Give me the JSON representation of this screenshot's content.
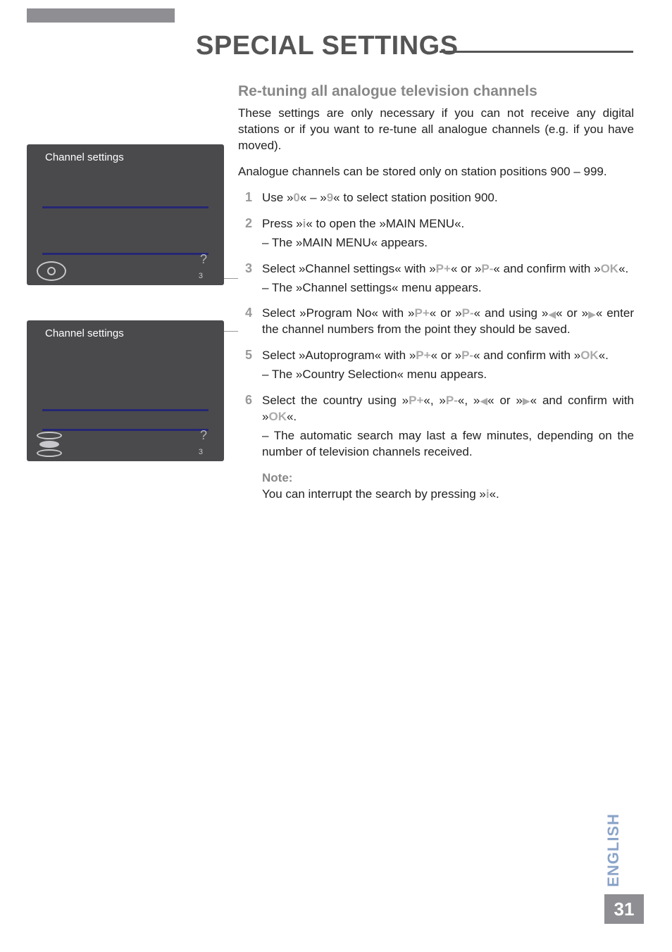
{
  "page": {
    "title": "SPECIAL SETTINGS",
    "language": "ENGLISH",
    "number": "31"
  },
  "sidebar": {
    "panel1": {
      "title": "Channel settings",
      "page": "3"
    },
    "panel2": {
      "title": "Channel settings",
      "page": "3"
    }
  },
  "content": {
    "heading": "Re-tuning all analogue television channels",
    "intro1": "These settings are only necessary if you can not receive any digital stations or if you want to re-tune all analogue channels (e.g. if you have moved).",
    "intro2_a": "Analogue channels can be stored only on station positions ",
    "intro2_b": "900 – 999.",
    "steps": {
      "s1": {
        "n": "1",
        "a": "Use »",
        "b0": "0",
        "b": "« – »",
        "b9": "9",
        "c": "« to select station position 900."
      },
      "s2": {
        "n": "2",
        "a": "Press »",
        "ik": "i",
        "b": "« to open the »MAIN MENU«.",
        "sub": "– The »MAIN MENU« appears."
      },
      "s3": {
        "n": "3",
        "a": "Select »Channel settings« with »",
        "pplus": "P+",
        "b": "« or »",
        "pmin": "P-",
        "c": "« and confirm with »",
        "ok": "OK",
        "d": "«.",
        "sub": "– The »Channel settings« menu appears."
      },
      "s4": {
        "n": "4",
        "a": "Select »Program No« with »",
        "pplus": "P+",
        "b": "« or »",
        "pmin": "P-",
        "c": "« and using »",
        "d": "« or »",
        "e": "« enter the channel numbers from the point they should be saved."
      },
      "s5": {
        "n": "5",
        "a": "Select »Autoprogram« with »",
        "pplus": "P+",
        "b": "« or »",
        "pmin": "P-",
        "c": "« and confirm with »",
        "ok": "OK",
        "d": "«.",
        "sub": "– The »Country Selection« menu appears."
      },
      "s6": {
        "n": "6",
        "a": "Select the country using »",
        "pplus": "P+",
        "b": "«, »",
        "pmin": "P-",
        "c": "«, »",
        "d": "« or »",
        "e": "« and confirm with »",
        "ok": "OK",
        "f": "«.",
        "sub": "– The automatic search may last a few minutes, depending on the number of television channels received."
      }
    },
    "note": {
      "label": "Note:",
      "a": "You can interrupt the search by pressing »",
      "ik": "i",
      "b": "«."
    }
  }
}
